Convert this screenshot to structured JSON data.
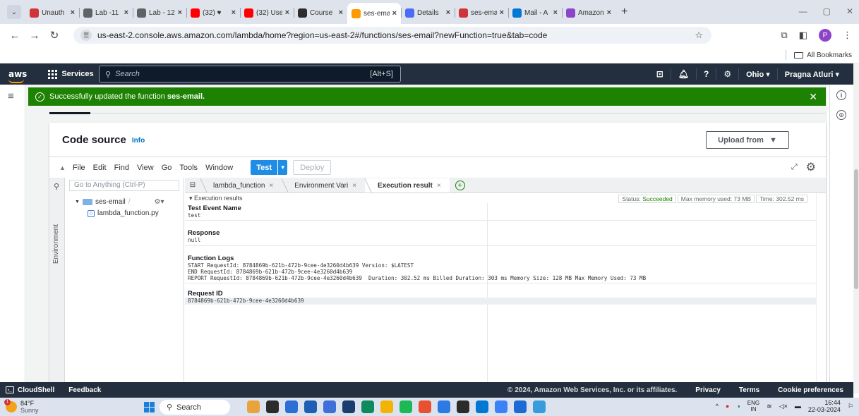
{
  "browser": {
    "tabs": [
      {
        "label": "Unauth",
        "fav": "#d13438"
      },
      {
        "label": "Lab -11",
        "fav": "#5f6368"
      },
      {
        "label": "Lab - 12",
        "fav": "#5f6368"
      },
      {
        "label": "(32) ♥",
        "fav": "#ff0000"
      },
      {
        "label": "(32) Use",
        "fav": "#ff0000"
      },
      {
        "label": "Course",
        "fav": "#2d2d2d"
      },
      {
        "label": "ses-ema",
        "fav": "#ff9900",
        "active": true
      },
      {
        "label": "Details",
        "fav": "#4a6cf7"
      },
      {
        "label": "ses-ema",
        "fav": "#d13438"
      },
      {
        "label": "Mail - A",
        "fav": "#0078d4"
      },
      {
        "label": "Amazon",
        "fav": "#8e44c9"
      }
    ],
    "url": "us-east-2.console.aws.amazon.com/lambda/home?region=us-east-2#/functions/ses-email?newFunction=true&tab=code",
    "all_bookmarks": "All Bookmarks",
    "profile_initial": "P"
  },
  "aws_nav": {
    "logo": "aws",
    "services": "Services",
    "search_placeholder": "Search",
    "search_shortcut": "[Alt+S]",
    "region": "Ohio ▾",
    "user": "Pragna Atluri ▾"
  },
  "flash": {
    "message": "Successfully updated the function",
    "function_name": "ses-email."
  },
  "code_source": {
    "title": "Code source",
    "info": "Info",
    "upload_label": "Upload from",
    "menu": [
      "File",
      "Edit",
      "Find",
      "View",
      "Go",
      "Tools",
      "Window"
    ],
    "test_label": "Test",
    "deploy_label": "Deploy",
    "goto_placeholder": "Go to Anything (Ctrl-P)",
    "side_tab": "Environment",
    "tree": {
      "folder": "ses-email",
      "file": "lambda_function.py"
    },
    "editor_tabs": [
      {
        "label": "lambda_function",
        "active": false
      },
      {
        "label": "Environment Vari",
        "active": false
      },
      {
        "label": "Execution result",
        "active": true
      }
    ]
  },
  "results": {
    "header": "▾ Execution results",
    "status_label": "Status:",
    "status_value": "Succeeded",
    "max_memory": "Max memory used: 73 MB",
    "time": "Time: 302.52 ms",
    "test_event_title": "Test Event Name",
    "test_event_value": "test",
    "response_title": "Response",
    "response_value": "null",
    "logs_title": "Function Logs",
    "log_lines": [
      "START RequestId: 8784869b-621b-472b-9cee-4e3260d4b639 Version: $LATEST",
      "END RequestId: 8784869b-621b-472b-9cee-4e3260d4b639",
      "REPORT RequestId: 8784869b-621b-472b-9cee-4e3260d4b639  Duration: 302.52 ms Billed Duration: 303 ms Memory Size: 128 MB Max Memory Used: 73 MB"
    ],
    "request_id_title": "Request ID",
    "request_id_value": "8784869b-621b-472b-9cee-4e3260d4b639"
  },
  "footer": {
    "cloudshell": "CloudShell",
    "feedback": "Feedback",
    "copyright": "© 2024, Amazon Web Services, Inc. or its affiliates.",
    "privacy": "Privacy",
    "terms": "Terms",
    "cookies": "Cookie preferences"
  },
  "taskbar": {
    "weather_temp": "84°F",
    "weather_desc": "Sunny",
    "weather_badge": "1",
    "search": "Search",
    "lang_top": "ENG",
    "lang_bottom": "IN",
    "time": "16:44",
    "date": "22-03-2024",
    "app_colors": [
      "#e8a33d",
      "#2b2b2b",
      "#2b6fd6",
      "#1e5fb4",
      "#3f6fd8",
      "#1b3e6f",
      "#0f8a5f",
      "#f2b400",
      "#1db954",
      "#e8502f",
      "#2c7be5",
      "#2b2b2b",
      "#0078d4",
      "#3b82f6",
      "#1e6bd6",
      "#3a9bdc"
    ]
  }
}
